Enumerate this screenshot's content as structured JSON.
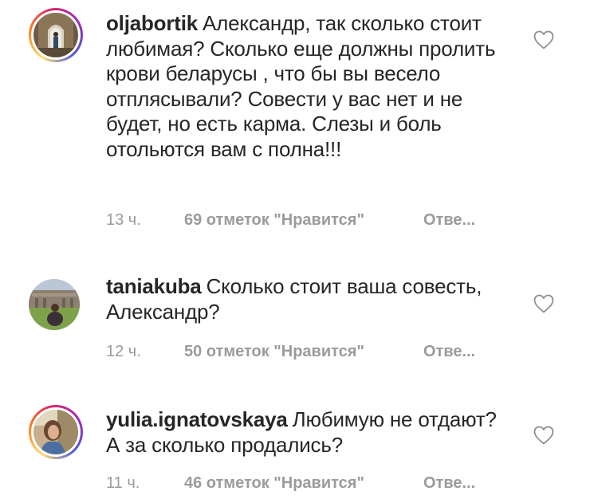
{
  "comments": [
    {
      "username": "oljabortik",
      "text": "Александр, так сколько стоит любимая? Сколько еще должны пролить крови беларусы , что бы вы весело отплясывали? Совести у вас нет и не будет, но есть карма. Слезы и боль отольются вам с полна!!!",
      "time": "13 ч.",
      "likes": "69 отметок \"Нравится\"",
      "reply": "Отве...",
      "avatar_ring": true,
      "like_icon": "heart-outline-icon"
    },
    {
      "username": "taniakuba",
      "text": "Сколько стоит ваша совесть, Александр?",
      "time": "12 ч.",
      "likes": "50 отметок \"Нравится\"",
      "reply": "Отве...",
      "avatar_ring": false,
      "like_icon": "heart-outline-icon"
    },
    {
      "username": "yulia.ignatovskaya",
      "text": "Любимую не отдают? А за сколько продались?",
      "time": "11 ч.",
      "likes": "46 отметок \"Нравится\"",
      "reply": "Отве...",
      "avatar_ring": true,
      "like_icon": "heart-outline-icon"
    }
  ],
  "colors": {
    "text": "#262626",
    "meta": "#9b9b9b",
    "heart": "#8e8e8e"
  }
}
